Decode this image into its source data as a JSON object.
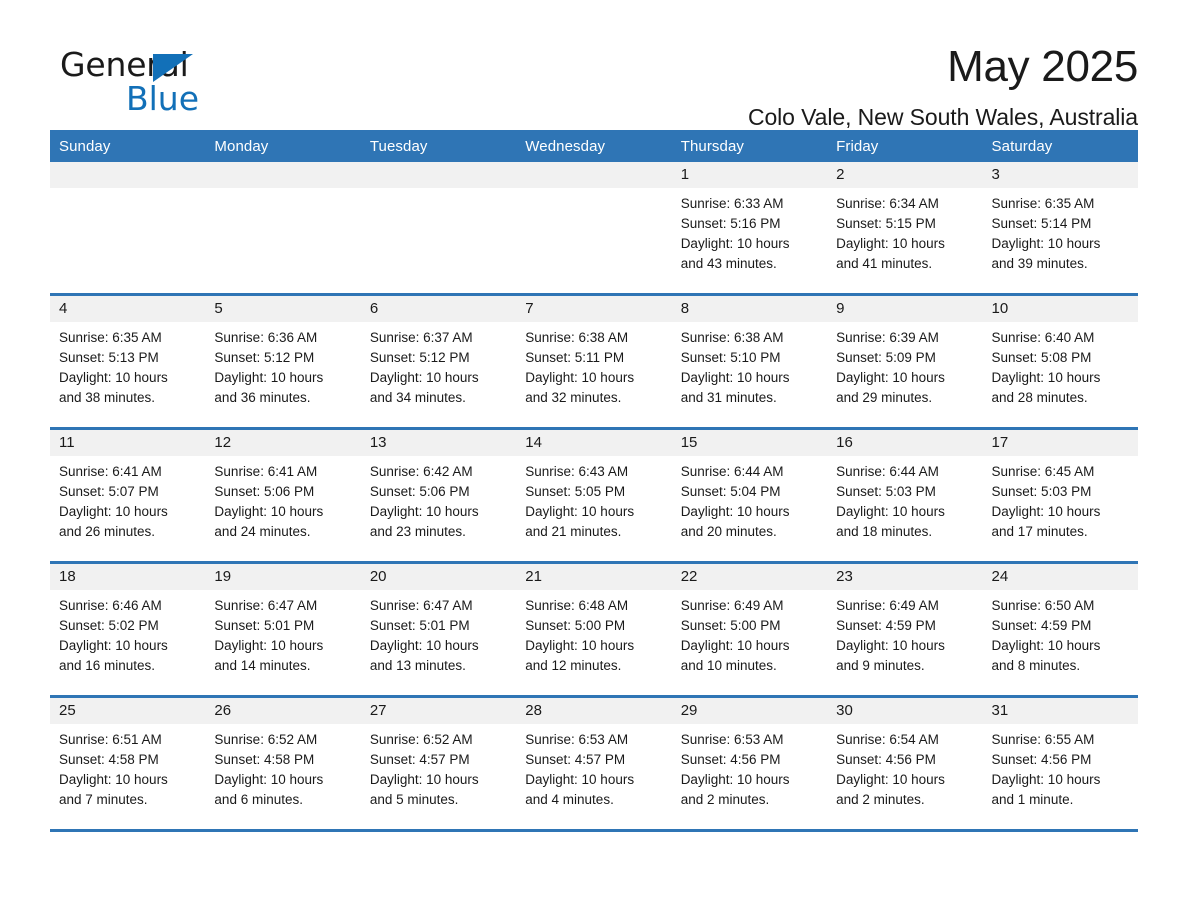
{
  "brand": {
    "word_general": "General",
    "word_blue": "Blue",
    "triangle_color": "#1270b8"
  },
  "header": {
    "title": "May 2025",
    "subtitle": "Colo Vale, New South Wales, Australia",
    "accent_color": "#2f75b5",
    "daynum_band_color": "#f1f1f1"
  },
  "weekday_headers": [
    "Sunday",
    "Monday",
    "Tuesday",
    "Wednesday",
    "Thursday",
    "Friday",
    "Saturday"
  ],
  "labels": {
    "sunrise_prefix": "Sunrise:",
    "sunset_prefix": "Sunset:",
    "daylight_prefix": "Daylight:"
  },
  "weeks": [
    [
      {
        "day": "",
        "sunrise": "",
        "sunset": "",
        "daylight_line1": "",
        "daylight_line2": ""
      },
      {
        "day": "",
        "sunrise": "",
        "sunset": "",
        "daylight_line1": "",
        "daylight_line2": ""
      },
      {
        "day": "",
        "sunrise": "",
        "sunset": "",
        "daylight_line1": "",
        "daylight_line2": ""
      },
      {
        "day": "",
        "sunrise": "",
        "sunset": "",
        "daylight_line1": "",
        "daylight_line2": ""
      },
      {
        "day": "1",
        "sunrise": "Sunrise: 6:33 AM",
        "sunset": "Sunset: 5:16 PM",
        "daylight_line1": "Daylight: 10 hours",
        "daylight_line2": "and 43 minutes."
      },
      {
        "day": "2",
        "sunrise": "Sunrise: 6:34 AM",
        "sunset": "Sunset: 5:15 PM",
        "daylight_line1": "Daylight: 10 hours",
        "daylight_line2": "and 41 minutes."
      },
      {
        "day": "3",
        "sunrise": "Sunrise: 6:35 AM",
        "sunset": "Sunset: 5:14 PM",
        "daylight_line1": "Daylight: 10 hours",
        "daylight_line2": "and 39 minutes."
      }
    ],
    [
      {
        "day": "4",
        "sunrise": "Sunrise: 6:35 AM",
        "sunset": "Sunset: 5:13 PM",
        "daylight_line1": "Daylight: 10 hours",
        "daylight_line2": "and 38 minutes."
      },
      {
        "day": "5",
        "sunrise": "Sunrise: 6:36 AM",
        "sunset": "Sunset: 5:12 PM",
        "daylight_line1": "Daylight: 10 hours",
        "daylight_line2": "and 36 minutes."
      },
      {
        "day": "6",
        "sunrise": "Sunrise: 6:37 AM",
        "sunset": "Sunset: 5:12 PM",
        "daylight_line1": "Daylight: 10 hours",
        "daylight_line2": "and 34 minutes."
      },
      {
        "day": "7",
        "sunrise": "Sunrise: 6:38 AM",
        "sunset": "Sunset: 5:11 PM",
        "daylight_line1": "Daylight: 10 hours",
        "daylight_line2": "and 32 minutes."
      },
      {
        "day": "8",
        "sunrise": "Sunrise: 6:38 AM",
        "sunset": "Sunset: 5:10 PM",
        "daylight_line1": "Daylight: 10 hours",
        "daylight_line2": "and 31 minutes."
      },
      {
        "day": "9",
        "sunrise": "Sunrise: 6:39 AM",
        "sunset": "Sunset: 5:09 PM",
        "daylight_line1": "Daylight: 10 hours",
        "daylight_line2": "and 29 minutes."
      },
      {
        "day": "10",
        "sunrise": "Sunrise: 6:40 AM",
        "sunset": "Sunset: 5:08 PM",
        "daylight_line1": "Daylight: 10 hours",
        "daylight_line2": "and 28 minutes."
      }
    ],
    [
      {
        "day": "11",
        "sunrise": "Sunrise: 6:41 AM",
        "sunset": "Sunset: 5:07 PM",
        "daylight_line1": "Daylight: 10 hours",
        "daylight_line2": "and 26 minutes."
      },
      {
        "day": "12",
        "sunrise": "Sunrise: 6:41 AM",
        "sunset": "Sunset: 5:06 PM",
        "daylight_line1": "Daylight: 10 hours",
        "daylight_line2": "and 24 minutes."
      },
      {
        "day": "13",
        "sunrise": "Sunrise: 6:42 AM",
        "sunset": "Sunset: 5:06 PM",
        "daylight_line1": "Daylight: 10 hours",
        "daylight_line2": "and 23 minutes."
      },
      {
        "day": "14",
        "sunrise": "Sunrise: 6:43 AM",
        "sunset": "Sunset: 5:05 PM",
        "daylight_line1": "Daylight: 10 hours",
        "daylight_line2": "and 21 minutes."
      },
      {
        "day": "15",
        "sunrise": "Sunrise: 6:44 AM",
        "sunset": "Sunset: 5:04 PM",
        "daylight_line1": "Daylight: 10 hours",
        "daylight_line2": "and 20 minutes."
      },
      {
        "day": "16",
        "sunrise": "Sunrise: 6:44 AM",
        "sunset": "Sunset: 5:03 PM",
        "daylight_line1": "Daylight: 10 hours",
        "daylight_line2": "and 18 minutes."
      },
      {
        "day": "17",
        "sunrise": "Sunrise: 6:45 AM",
        "sunset": "Sunset: 5:03 PM",
        "daylight_line1": "Daylight: 10 hours",
        "daylight_line2": "and 17 minutes."
      }
    ],
    [
      {
        "day": "18",
        "sunrise": "Sunrise: 6:46 AM",
        "sunset": "Sunset: 5:02 PM",
        "daylight_line1": "Daylight: 10 hours",
        "daylight_line2": "and 16 minutes."
      },
      {
        "day": "19",
        "sunrise": "Sunrise: 6:47 AM",
        "sunset": "Sunset: 5:01 PM",
        "daylight_line1": "Daylight: 10 hours",
        "daylight_line2": "and 14 minutes."
      },
      {
        "day": "20",
        "sunrise": "Sunrise: 6:47 AM",
        "sunset": "Sunset: 5:01 PM",
        "daylight_line1": "Daylight: 10 hours",
        "daylight_line2": "and 13 minutes."
      },
      {
        "day": "21",
        "sunrise": "Sunrise: 6:48 AM",
        "sunset": "Sunset: 5:00 PM",
        "daylight_line1": "Daylight: 10 hours",
        "daylight_line2": "and 12 minutes."
      },
      {
        "day": "22",
        "sunrise": "Sunrise: 6:49 AM",
        "sunset": "Sunset: 5:00 PM",
        "daylight_line1": "Daylight: 10 hours",
        "daylight_line2": "and 10 minutes."
      },
      {
        "day": "23",
        "sunrise": "Sunrise: 6:49 AM",
        "sunset": "Sunset: 4:59 PM",
        "daylight_line1": "Daylight: 10 hours",
        "daylight_line2": "and 9 minutes."
      },
      {
        "day": "24",
        "sunrise": "Sunrise: 6:50 AM",
        "sunset": "Sunset: 4:59 PM",
        "daylight_line1": "Daylight: 10 hours",
        "daylight_line2": "and 8 minutes."
      }
    ],
    [
      {
        "day": "25",
        "sunrise": "Sunrise: 6:51 AM",
        "sunset": "Sunset: 4:58 PM",
        "daylight_line1": "Daylight: 10 hours",
        "daylight_line2": "and 7 minutes."
      },
      {
        "day": "26",
        "sunrise": "Sunrise: 6:52 AM",
        "sunset": "Sunset: 4:58 PM",
        "daylight_line1": "Daylight: 10 hours",
        "daylight_line2": "and 6 minutes."
      },
      {
        "day": "27",
        "sunrise": "Sunrise: 6:52 AM",
        "sunset": "Sunset: 4:57 PM",
        "daylight_line1": "Daylight: 10 hours",
        "daylight_line2": "and 5 minutes."
      },
      {
        "day": "28",
        "sunrise": "Sunrise: 6:53 AM",
        "sunset": "Sunset: 4:57 PM",
        "daylight_line1": "Daylight: 10 hours",
        "daylight_line2": "and 4 minutes."
      },
      {
        "day": "29",
        "sunrise": "Sunrise: 6:53 AM",
        "sunset": "Sunset: 4:56 PM",
        "daylight_line1": "Daylight: 10 hours",
        "daylight_line2": "and 2 minutes."
      },
      {
        "day": "30",
        "sunrise": "Sunrise: 6:54 AM",
        "sunset": "Sunset: 4:56 PM",
        "daylight_line1": "Daylight: 10 hours",
        "daylight_line2": "and 2 minutes."
      },
      {
        "day": "31",
        "sunrise": "Sunrise: 6:55 AM",
        "sunset": "Sunset: 4:56 PM",
        "daylight_line1": "Daylight: 10 hours",
        "daylight_line2": "and 1 minute."
      }
    ]
  ]
}
